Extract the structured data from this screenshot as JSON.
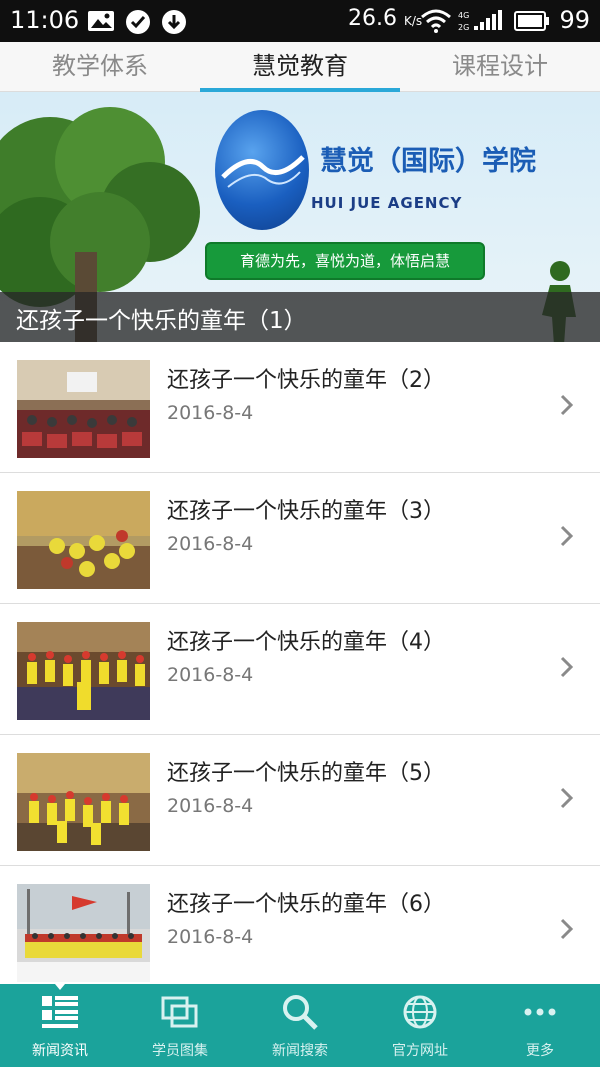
{
  "status_bar": {
    "time": "11:06",
    "network_speed": "26.6",
    "speed_unit": "K/s",
    "battery": "99",
    "icons": [
      "image-icon",
      "check-circle-icon",
      "download-circle-icon",
      "wifi-icon",
      "cell-signal-icon",
      "battery-icon"
    ]
  },
  "tabs": [
    {
      "label": "教学体系",
      "active": false
    },
    {
      "label": "慧觉教育",
      "active": true
    },
    {
      "label": "课程设计",
      "active": false
    }
  ],
  "banner": {
    "school_name": "慧觉（国际）学院",
    "agency": "HUI JUE   AGENCY",
    "slogan": "育德为先，喜悦为道，体悟启慧",
    "caption": "还孩子一个快乐的童年（1）"
  },
  "news": [
    {
      "title": "还孩子一个快乐的童年（2）",
      "date": "2016-8-4"
    },
    {
      "title": "还孩子一个快乐的童年（3）",
      "date": "2016-8-4"
    },
    {
      "title": "还孩子一个快乐的童年（4）",
      "date": "2016-8-4"
    },
    {
      "title": "还孩子一个快乐的童年（5）",
      "date": "2016-8-4"
    },
    {
      "title": "还孩子一个快乐的童年（6）",
      "date": "2016-8-4"
    }
  ],
  "bottom_nav": [
    {
      "label": "新闻资讯",
      "icon": "news-list-icon",
      "active": true
    },
    {
      "label": "学员图集",
      "icon": "gallery-icon",
      "active": false
    },
    {
      "label": "新闻搜索",
      "icon": "search-icon",
      "active": false
    },
    {
      "label": "官方网址",
      "icon": "globe-icon",
      "active": false
    },
    {
      "label": "更多",
      "icon": "more-icon",
      "active": false
    }
  ],
  "colors": {
    "accent": "#2aa8d8",
    "nav_bg": "#1ba39b",
    "slogan_bg": "#179a3b"
  }
}
